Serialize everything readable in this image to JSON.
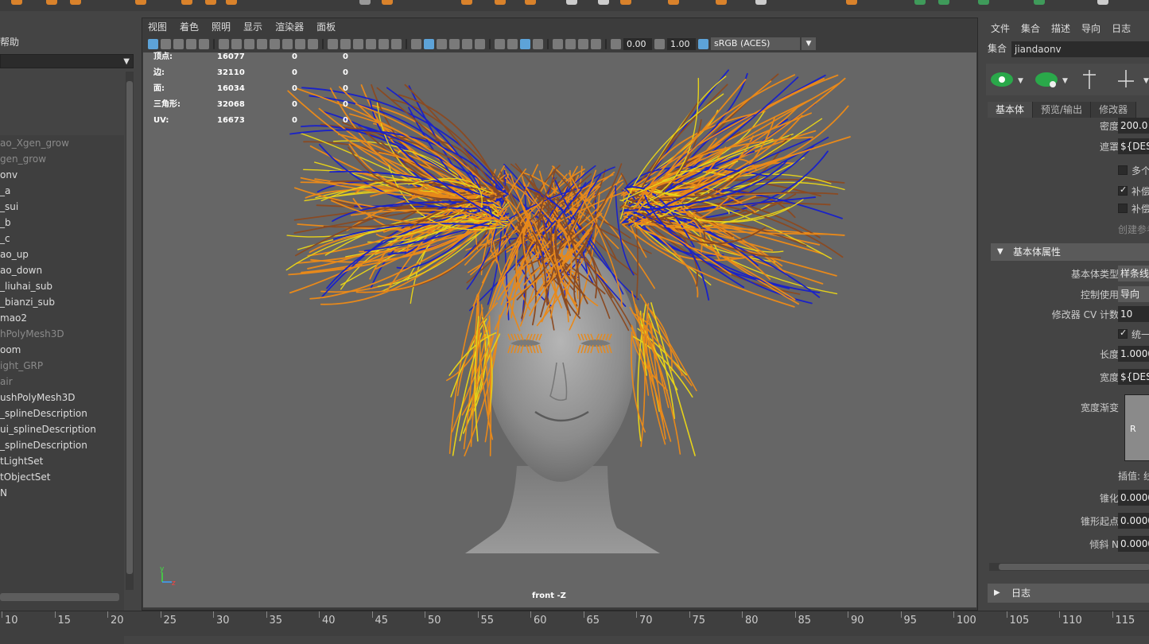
{
  "outliner": {
    "help_menu": "帮助",
    "items": [
      {
        "label": "ao_Xgen_grow",
        "dim": true
      },
      {
        "label": "gen_grow",
        "dim": true
      },
      {
        "label": "onv",
        "dim": false
      },
      {
        "label": "_a",
        "dim": false
      },
      {
        "label": "_sui",
        "dim": false
      },
      {
        "label": "_b",
        "dim": false
      },
      {
        "label": "_c",
        "dim": false
      },
      {
        "label": "ao_up",
        "dim": false
      },
      {
        "label": "ao_down",
        "dim": false
      },
      {
        "label": "_liuhai_sub",
        "dim": false
      },
      {
        "label": "_bianzi_sub",
        "dim": false
      },
      {
        "label": "mao2",
        "dim": false
      },
      {
        "label": "hPolyMesh3D",
        "dim": true
      },
      {
        "label": "oom",
        "dim": false
      },
      {
        "label": "ight_GRP",
        "dim": true
      },
      {
        "label": "air",
        "dim": true
      },
      {
        "label": "ushPolyMesh3D",
        "dim": false
      },
      {
        "label": "_splineDescription",
        "dim": false
      },
      {
        "label": "ui_splineDescription",
        "dim": false
      },
      {
        "label": "_splineDescription",
        "dim": false
      },
      {
        "label": "tLightSet",
        "dim": false
      },
      {
        "label": "tObjectSet",
        "dim": false
      },
      {
        "label": "N",
        "dim": false
      }
    ]
  },
  "viewport": {
    "menus": [
      "视图",
      "着色",
      "照明",
      "显示",
      "渲染器",
      "面板"
    ],
    "exposure": "0.00",
    "gamma": "1.00",
    "color_space": "sRGB (ACES)",
    "camera_label": "front -Z",
    "hud": [
      {
        "label": "顶点:",
        "v1": "16077",
        "v2": "0",
        "v3": "0"
      },
      {
        "label": "边:",
        "v1": "32110",
        "v2": "0",
        "v3": "0"
      },
      {
        "label": "面:",
        "v1": "16034",
        "v2": "0",
        "v3": "0"
      },
      {
        "label": "三角形:",
        "v1": "32068",
        "v2": "0",
        "v3": "0"
      },
      {
        "label": "UV:",
        "v1": "16673",
        "v2": "0",
        "v3": "0"
      }
    ],
    "axis_y": "y",
    "axis_z": "z"
  },
  "attribute_editor": {
    "menus": [
      "文件",
      "集合",
      "描述",
      "导向",
      "日志"
    ],
    "set_label": "集合",
    "set_value": "jiandaonv",
    "tabs": [
      "基本体",
      "预览/输出",
      "修改器"
    ],
    "density_label": "密度",
    "density_value": "200.0",
    "mask_label": "遮罩",
    "mask_value": "${DESC}",
    "check_multi": "多个",
    "check_comp1": "补偿",
    "check_comp2": "补偿",
    "create_ref": "创建参考",
    "section_primitive": "基本体属性",
    "prim_type_label": "基本体类型",
    "prim_type_value": "样条线",
    "control_label": "控制使用",
    "control_value": "导向",
    "cv_label": "修改器 CV 计数",
    "cv_value": "10",
    "unify_label": "统一",
    "length_label": "长度",
    "length_value": "1.0000",
    "width_label": "宽度",
    "width_value": "${DESC}",
    "width_ramp_label": "宽度渐变",
    "ramp_r": "R",
    "interp_label": "插值:",
    "interp_value": "线",
    "taper_label": "锥化",
    "taper_value": "0.0000",
    "taper_start_label": "锥形起点",
    "taper_start_value": "0.0000",
    "tilt_label": "倾斜 N",
    "tilt_value": "0.0000",
    "log_section": "日志"
  },
  "timeline": {
    "ticks": [
      "10",
      "15",
      "20",
      "25",
      "30",
      "35",
      "40",
      "45",
      "50",
      "55",
      "60",
      "65",
      "70",
      "75",
      "80",
      "85",
      "90",
      "95",
      "100",
      "105",
      "110",
      "115"
    ]
  },
  "colors": {
    "hair_orange": "#e8891a",
    "hair_yellow": "#e6d21a",
    "hair_blue": "#1a22c8",
    "hair_brown": "#8a4a22",
    "viewport_bg": "#666666",
    "accent_blue": "#5da3d8"
  }
}
